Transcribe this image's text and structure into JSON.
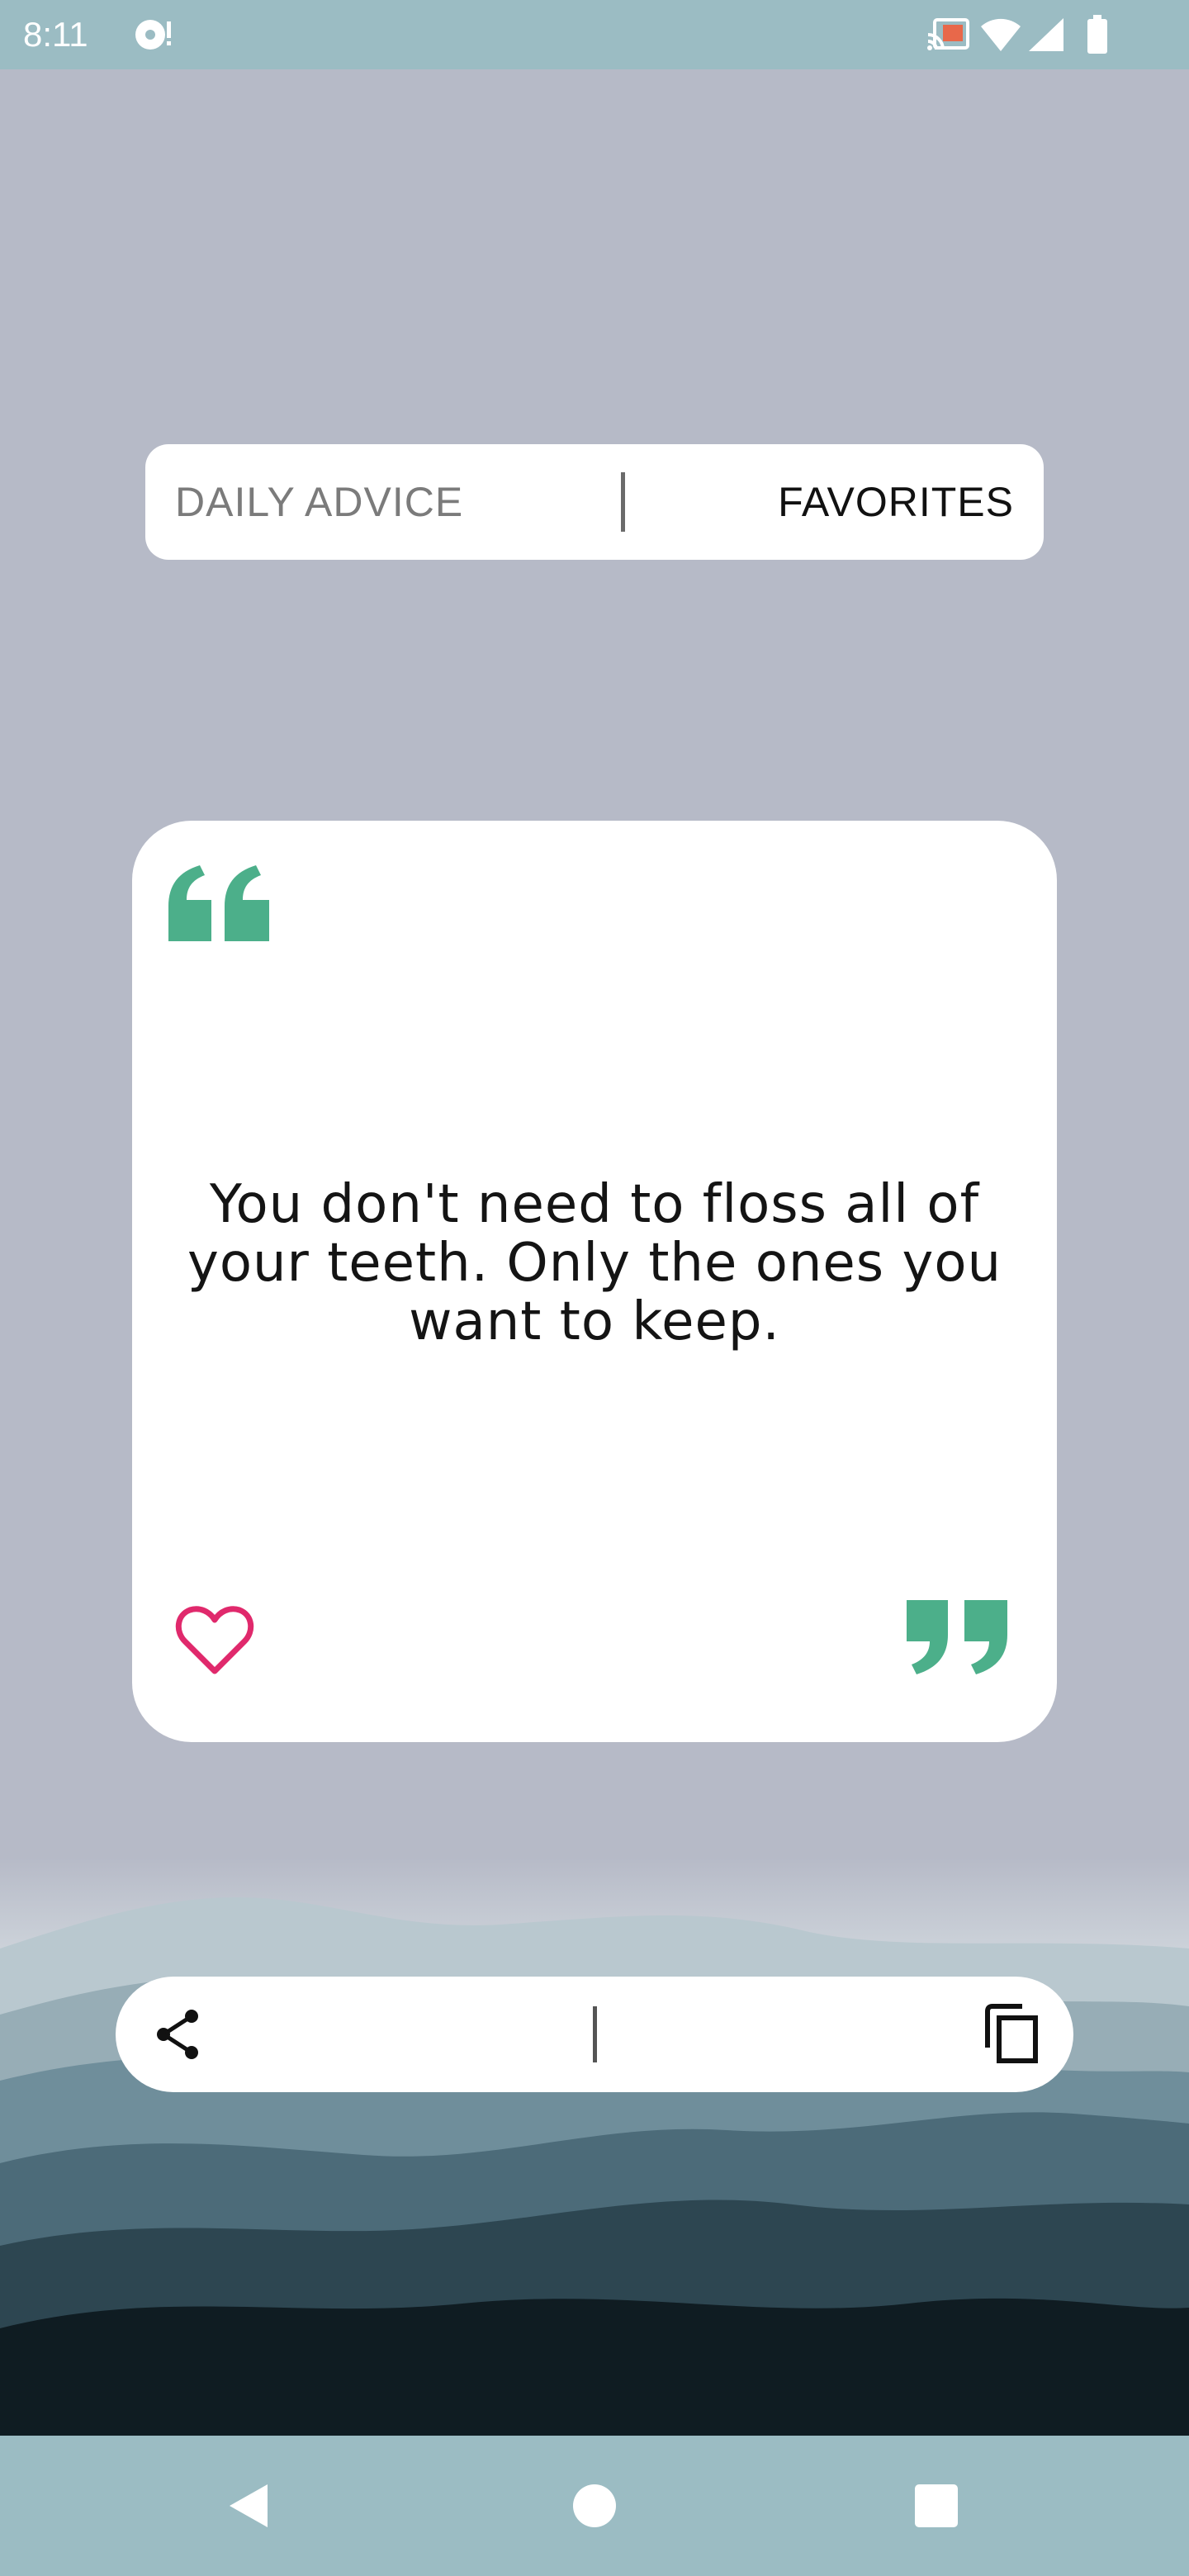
{
  "status_bar": {
    "time": "8:11",
    "icons": [
      "media-notification-icon",
      "cast-icon",
      "wifi-icon",
      "signal-icon",
      "battery-icon"
    ]
  },
  "tabs": {
    "daily_advice": "DAILY ADVICE",
    "favorites": "FAVORITES"
  },
  "quote_card": {
    "text": "You don't need to floss all of your teeth. Only the ones you want to keep.",
    "favorite_icon": "heart-outline-icon",
    "quote_icons": [
      "open-quote-icon",
      "close-quote-icon"
    ]
  },
  "action_bar": {
    "icons": [
      "share-icon",
      "copy-icon"
    ]
  },
  "nav_bar": {
    "icons": [
      "back-icon",
      "home-icon",
      "recents-icon"
    ]
  },
  "colors": {
    "background": "#b6bac7",
    "system_bars": "#9bbcc3",
    "quote_accent": "#4caf8a",
    "heart": "#e0296c",
    "card": "#ffffff"
  }
}
